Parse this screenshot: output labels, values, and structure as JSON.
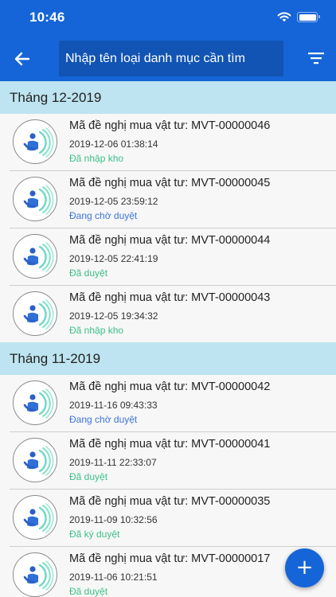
{
  "status_bar": {
    "time": "10:46"
  },
  "header": {
    "search_placeholder": "Nhập tên loại danh mục cần tìm",
    "back_icon": "arrow-left-icon",
    "filter_icon": "filter-icon"
  },
  "colors": {
    "primary": "#1565d8",
    "section_bg": "#bde4f0",
    "status_green": "#3cc08a",
    "status_blue": "#3d74d6"
  },
  "sections": [
    {
      "label": "Tháng 12-2019",
      "items": [
        {
          "title": "Mã đề nghị mua vật tư: MVT-00000046",
          "date": "2019-12-06 01:38:14",
          "status": "Đã nhập kho",
          "status_color": "#3cc08a"
        },
        {
          "title": "Mã đề nghị mua vật tư: MVT-00000045",
          "date": "2019-12-05 23:59:12",
          "status": "Đang chờ duyệt",
          "status_color": "#3d74d6"
        },
        {
          "title": "Mã đề nghị mua vật tư: MVT-00000044",
          "date": "2019-12-05 22:41:19",
          "status": "Đã duyệt",
          "status_color": "#3cc08a"
        },
        {
          "title": "Mã đề nghị mua vật tư: MVT-00000043",
          "date": "2019-12-05 19:34:32",
          "status": "Đã nhập kho",
          "status_color": "#3cc08a"
        }
      ]
    },
    {
      "label": "Tháng 11-2019",
      "items": [
        {
          "title": "Mã đề nghị mua vật tư: MVT-00000042",
          "date": "2019-11-16 09:43:33",
          "status": "Đang chờ duyệt",
          "status_color": "#3d74d6"
        },
        {
          "title": "Mã đề nghị mua vật tư: MVT-00000041",
          "date": "2019-11-11 22:33:07",
          "status": "Đã duyệt",
          "status_color": "#3cc08a"
        },
        {
          "title": "Mã đề nghị mua vật tư: MVT-00000035",
          "date": "2019-11-09 10:32:56",
          "status": "Đã ký duyệt",
          "status_color": "#3cc08a"
        },
        {
          "title": "Mã đề nghị mua vật tư: MVT-00000017",
          "date": "2019-11-06 10:21:51",
          "status": "Đã duyệt",
          "status_color": "#3cc08a"
        }
      ]
    }
  ],
  "fab": {
    "label": "+",
    "icon": "plus-icon"
  }
}
